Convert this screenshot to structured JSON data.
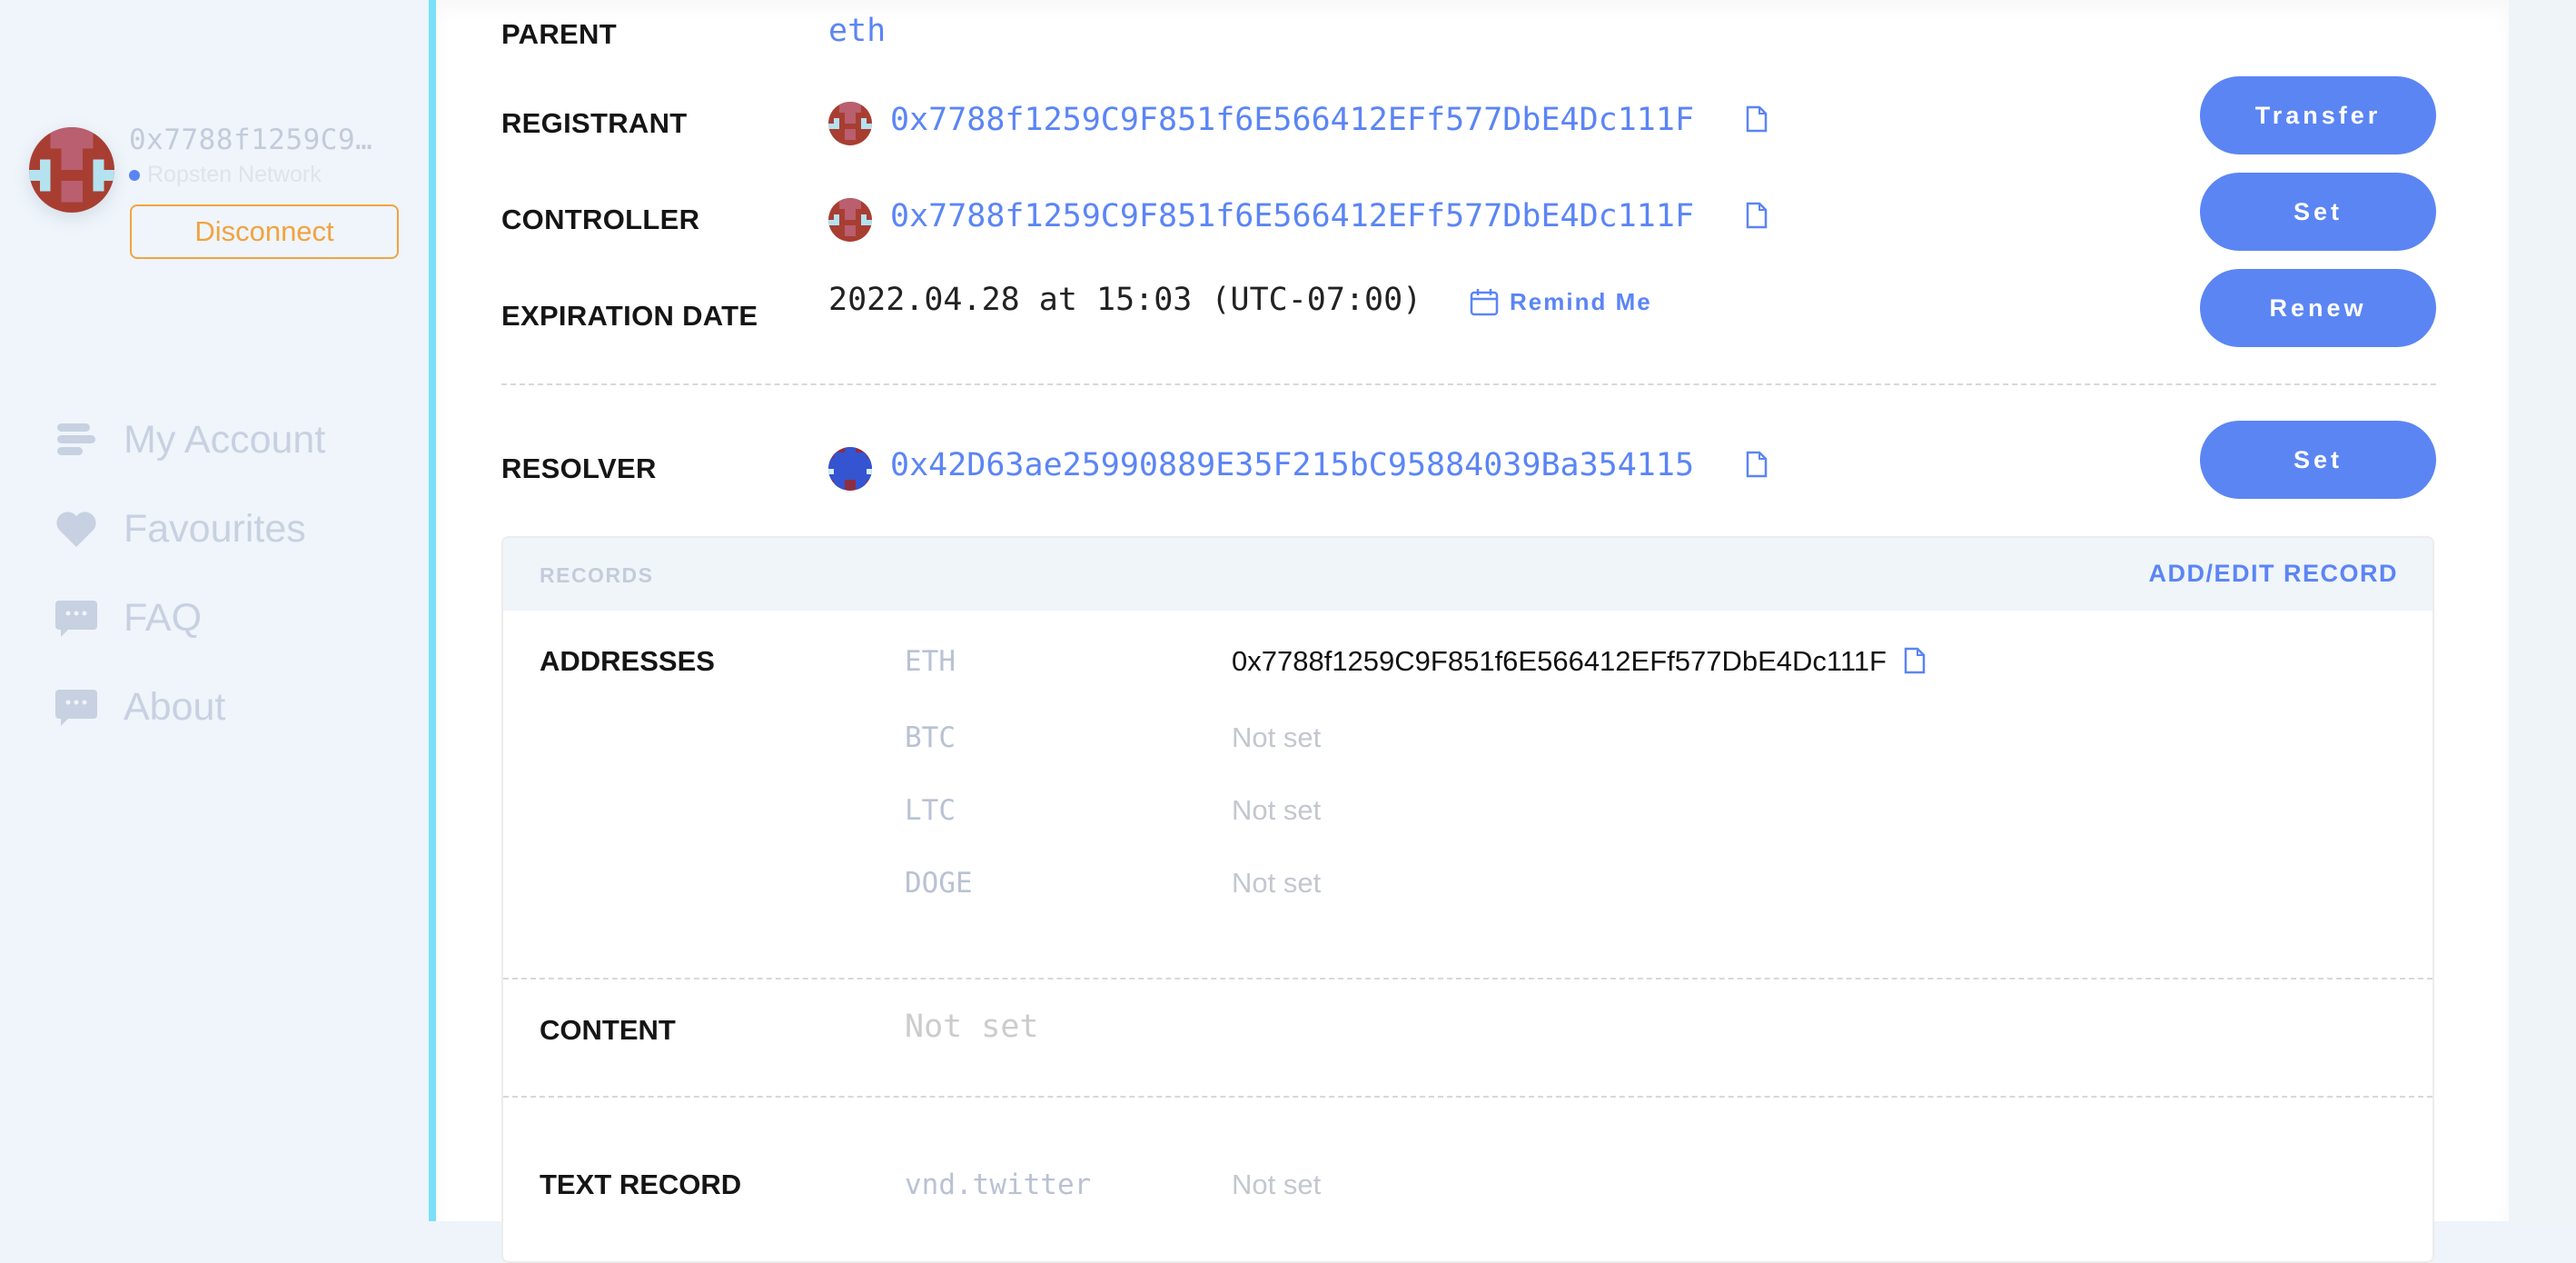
{
  "sidebar": {
    "account": {
      "address": "0x7788f1259C9…",
      "network": "Ropsten Network",
      "network_dot_color": "#5b85f5",
      "disconnect_label": "Disconnect"
    },
    "nav": [
      {
        "label": "My Account",
        "icon": "list-icon"
      },
      {
        "label": "Favourites",
        "icon": "heart-icon"
      },
      {
        "label": "FAQ",
        "icon": "chat-bubble-icon"
      },
      {
        "label": "About",
        "icon": "chat-bubble-icon"
      }
    ]
  },
  "details": {
    "parent": {
      "label": "PARENT",
      "value": "eth"
    },
    "registrant": {
      "label": "REGISTRANT",
      "value": "0x7788f1259C9F851f6E566412EFf577DbE4Dc111F",
      "button": "Transfer"
    },
    "controller": {
      "label": "CONTROLLER",
      "value": "0x7788f1259C9F851f6E566412EFf577DbE4Dc111F",
      "button": "Set"
    },
    "expiration": {
      "label": "EXPIRATION DATE",
      "value": "2022.04.28 at 15:03 (UTC-07:00)",
      "remind_label": "Remind Me",
      "button": "Renew"
    },
    "resolver": {
      "label": "RESOLVER",
      "value": "0x42D63ae25990889E35F215bC95884039Ba354115",
      "button": "Set"
    }
  },
  "records": {
    "title": "RECORDS",
    "add_edit_label": "ADD/EDIT RECORD",
    "addresses": {
      "label": "ADDRESSES",
      "items": [
        {
          "key": "ETH",
          "value": "0x7788f1259C9F851f6E566412EFf577DbE4Dc111F",
          "set": true
        },
        {
          "key": "BTC",
          "value": "Not set",
          "set": false
        },
        {
          "key": "LTC",
          "value": "Not set",
          "set": false
        },
        {
          "key": "DOGE",
          "value": "Not set",
          "set": false
        }
      ]
    },
    "content": {
      "label": "CONTENT",
      "value": "Not set"
    },
    "text_record": {
      "label": "TEXT RECORD",
      "key": "vnd.twitter",
      "value": "Not set"
    }
  },
  "colors": {
    "accent": "#5b85f5",
    "warning": "#f1a340",
    "stripe": "#7ae0f8"
  }
}
